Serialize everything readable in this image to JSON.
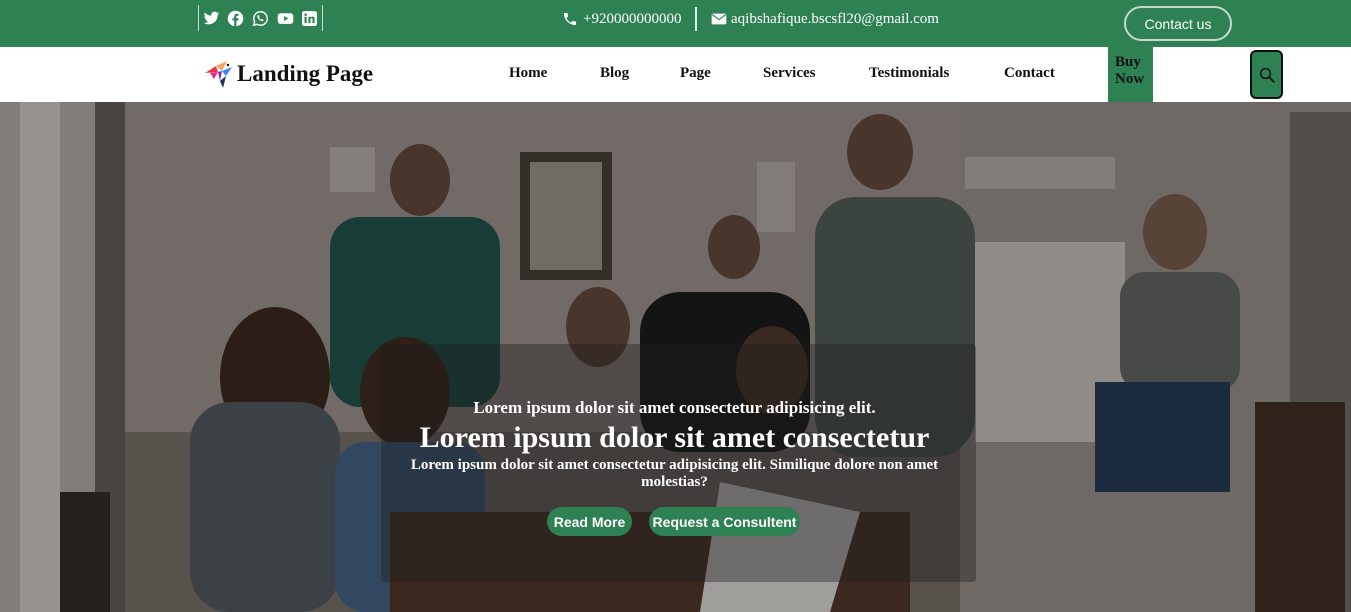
{
  "topbar": {
    "social_icons": [
      "twitter-icon",
      "facebook-icon",
      "whatsapp-icon",
      "youtube-icon",
      "linkedin-icon"
    ],
    "phone": "+920000000000",
    "email": "aqibshafique.bscsfl20@gmail.com",
    "contact_button": "Contact us"
  },
  "navbar": {
    "brand": "Landing Page",
    "links": [
      "Home",
      "Blog",
      "Page",
      "Services",
      "Testimonials",
      "Contact"
    ],
    "buy_line1": "Buy",
    "buy_line2": "Now",
    "search_icon": "search-icon"
  },
  "hero": {
    "subtitle": "Lorem ipsum dolor sit amet consectetur adipisicing elit.",
    "title": "Lorem ipsum dolor sit amet consectetur",
    "description": "Lorem ipsum dolor sit amet consectetur adipisicing elit. Similique dolore non amet molestias?",
    "read_more": "Read More",
    "consult": "Request a Consultent"
  },
  "colors": {
    "brand_green": "#2e8153",
    "text_dark": "#111111",
    "white": "#ffffff"
  }
}
